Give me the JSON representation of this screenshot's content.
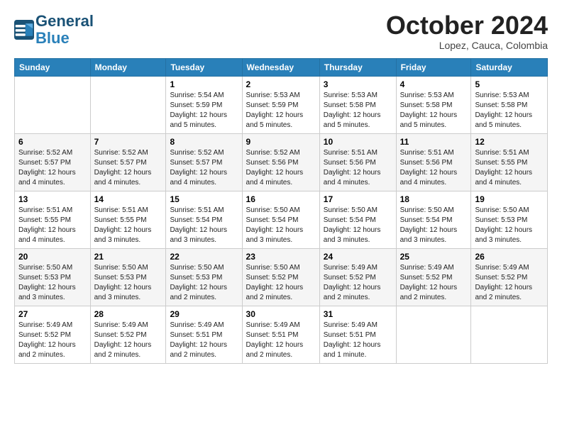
{
  "logo": {
    "line1": "General",
    "line2": "Blue"
  },
  "title": "October 2024",
  "location": "Lopez, Cauca, Colombia",
  "days_header": [
    "Sunday",
    "Monday",
    "Tuesday",
    "Wednesday",
    "Thursday",
    "Friday",
    "Saturday"
  ],
  "weeks": [
    [
      {
        "day": "",
        "info": ""
      },
      {
        "day": "",
        "info": ""
      },
      {
        "day": "1",
        "info": "Sunrise: 5:54 AM\nSunset: 5:59 PM\nDaylight: 12 hours\nand 5 minutes."
      },
      {
        "day": "2",
        "info": "Sunrise: 5:53 AM\nSunset: 5:59 PM\nDaylight: 12 hours\nand 5 minutes."
      },
      {
        "day": "3",
        "info": "Sunrise: 5:53 AM\nSunset: 5:58 PM\nDaylight: 12 hours\nand 5 minutes."
      },
      {
        "day": "4",
        "info": "Sunrise: 5:53 AM\nSunset: 5:58 PM\nDaylight: 12 hours\nand 5 minutes."
      },
      {
        "day": "5",
        "info": "Sunrise: 5:53 AM\nSunset: 5:58 PM\nDaylight: 12 hours\nand 5 minutes."
      }
    ],
    [
      {
        "day": "6",
        "info": "Sunrise: 5:52 AM\nSunset: 5:57 PM\nDaylight: 12 hours\nand 4 minutes."
      },
      {
        "day": "7",
        "info": "Sunrise: 5:52 AM\nSunset: 5:57 PM\nDaylight: 12 hours\nand 4 minutes."
      },
      {
        "day": "8",
        "info": "Sunrise: 5:52 AM\nSunset: 5:57 PM\nDaylight: 12 hours\nand 4 minutes."
      },
      {
        "day": "9",
        "info": "Sunrise: 5:52 AM\nSunset: 5:56 PM\nDaylight: 12 hours\nand 4 minutes."
      },
      {
        "day": "10",
        "info": "Sunrise: 5:51 AM\nSunset: 5:56 PM\nDaylight: 12 hours\nand 4 minutes."
      },
      {
        "day": "11",
        "info": "Sunrise: 5:51 AM\nSunset: 5:56 PM\nDaylight: 12 hours\nand 4 minutes."
      },
      {
        "day": "12",
        "info": "Sunrise: 5:51 AM\nSunset: 5:55 PM\nDaylight: 12 hours\nand 4 minutes."
      }
    ],
    [
      {
        "day": "13",
        "info": "Sunrise: 5:51 AM\nSunset: 5:55 PM\nDaylight: 12 hours\nand 4 minutes."
      },
      {
        "day": "14",
        "info": "Sunrise: 5:51 AM\nSunset: 5:55 PM\nDaylight: 12 hours\nand 3 minutes."
      },
      {
        "day": "15",
        "info": "Sunrise: 5:51 AM\nSunset: 5:54 PM\nDaylight: 12 hours\nand 3 minutes."
      },
      {
        "day": "16",
        "info": "Sunrise: 5:50 AM\nSunset: 5:54 PM\nDaylight: 12 hours\nand 3 minutes."
      },
      {
        "day": "17",
        "info": "Sunrise: 5:50 AM\nSunset: 5:54 PM\nDaylight: 12 hours\nand 3 minutes."
      },
      {
        "day": "18",
        "info": "Sunrise: 5:50 AM\nSunset: 5:54 PM\nDaylight: 12 hours\nand 3 minutes."
      },
      {
        "day": "19",
        "info": "Sunrise: 5:50 AM\nSunset: 5:53 PM\nDaylight: 12 hours\nand 3 minutes."
      }
    ],
    [
      {
        "day": "20",
        "info": "Sunrise: 5:50 AM\nSunset: 5:53 PM\nDaylight: 12 hours\nand 3 minutes."
      },
      {
        "day": "21",
        "info": "Sunrise: 5:50 AM\nSunset: 5:53 PM\nDaylight: 12 hours\nand 3 minutes."
      },
      {
        "day": "22",
        "info": "Sunrise: 5:50 AM\nSunset: 5:53 PM\nDaylight: 12 hours\nand 2 minutes."
      },
      {
        "day": "23",
        "info": "Sunrise: 5:50 AM\nSunset: 5:52 PM\nDaylight: 12 hours\nand 2 minutes."
      },
      {
        "day": "24",
        "info": "Sunrise: 5:49 AM\nSunset: 5:52 PM\nDaylight: 12 hours\nand 2 minutes."
      },
      {
        "day": "25",
        "info": "Sunrise: 5:49 AM\nSunset: 5:52 PM\nDaylight: 12 hours\nand 2 minutes."
      },
      {
        "day": "26",
        "info": "Sunrise: 5:49 AM\nSunset: 5:52 PM\nDaylight: 12 hours\nand 2 minutes."
      }
    ],
    [
      {
        "day": "27",
        "info": "Sunrise: 5:49 AM\nSunset: 5:52 PM\nDaylight: 12 hours\nand 2 minutes."
      },
      {
        "day": "28",
        "info": "Sunrise: 5:49 AM\nSunset: 5:52 PM\nDaylight: 12 hours\nand 2 minutes."
      },
      {
        "day": "29",
        "info": "Sunrise: 5:49 AM\nSunset: 5:51 PM\nDaylight: 12 hours\nand 2 minutes."
      },
      {
        "day": "30",
        "info": "Sunrise: 5:49 AM\nSunset: 5:51 PM\nDaylight: 12 hours\nand 2 minutes."
      },
      {
        "day": "31",
        "info": "Sunrise: 5:49 AM\nSunset: 5:51 PM\nDaylight: 12 hours\nand 1 minute."
      },
      {
        "day": "",
        "info": ""
      },
      {
        "day": "",
        "info": ""
      }
    ]
  ]
}
